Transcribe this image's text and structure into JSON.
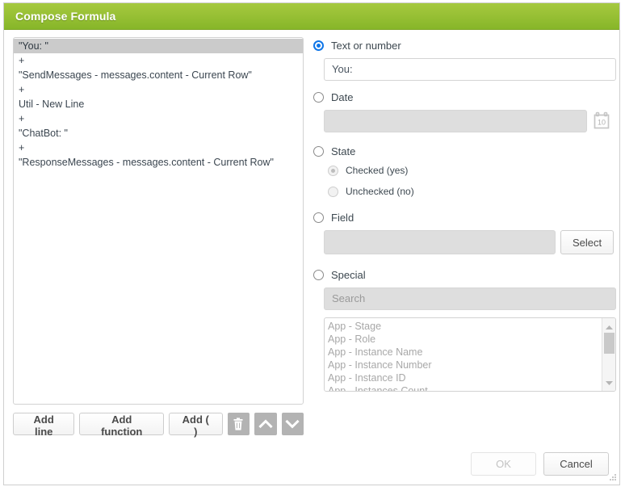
{
  "dialog": {
    "title": "Compose Formula"
  },
  "formula": {
    "lines": [
      {
        "text": "\"You: \"",
        "selected": true
      },
      {
        "text": "+",
        "selected": false
      },
      {
        "text": "\"SendMessages - messages.content - Current Row\"",
        "selected": false
      },
      {
        "text": "+",
        "selected": false
      },
      {
        "text": "Util - New Line",
        "selected": false
      },
      {
        "text": "+",
        "selected": false
      },
      {
        "text": "\"ChatBot: \"",
        "selected": false
      },
      {
        "text": "+",
        "selected": false
      },
      {
        "text": "\"ResponseMessages - messages.content - Current Row\"",
        "selected": false
      }
    ]
  },
  "toolbar": {
    "add_line_label": "Add line",
    "add_function_label": "Add function",
    "add_parens_label": "Add ( )",
    "delete_icon": "trash-icon",
    "move_up_icon": "chevron-up-icon",
    "move_down_icon": "chevron-down-icon"
  },
  "options": {
    "text_or_number": {
      "label": "Text or number",
      "selected": true,
      "value": "You: "
    },
    "date": {
      "label": "Date",
      "selected": false,
      "value": "",
      "calendar_icon_day": "10"
    },
    "state": {
      "label": "State",
      "selected": false,
      "choices": [
        {
          "label": "Checked (yes)",
          "selected": true
        },
        {
          "label": "Unchecked (no)",
          "selected": false
        }
      ]
    },
    "field": {
      "label": "Field",
      "selected": false,
      "value": "",
      "select_button_label": "Select"
    },
    "special": {
      "label": "Special",
      "selected": false,
      "search_placeholder": "Search",
      "items": [
        "App - Stage",
        "App - Role",
        "App - Instance Name",
        "App - Instance Number",
        "App - Instance ID",
        "App - Instances Count"
      ]
    }
  },
  "footer": {
    "ok_label": "OK",
    "ok_disabled": true,
    "cancel_label": "Cancel"
  },
  "colors": {
    "header_green_top": "#a6c93f",
    "header_green_bottom": "#87b629",
    "accent_blue": "#1076e8",
    "selected_row_grey": "#cbcbcb"
  }
}
